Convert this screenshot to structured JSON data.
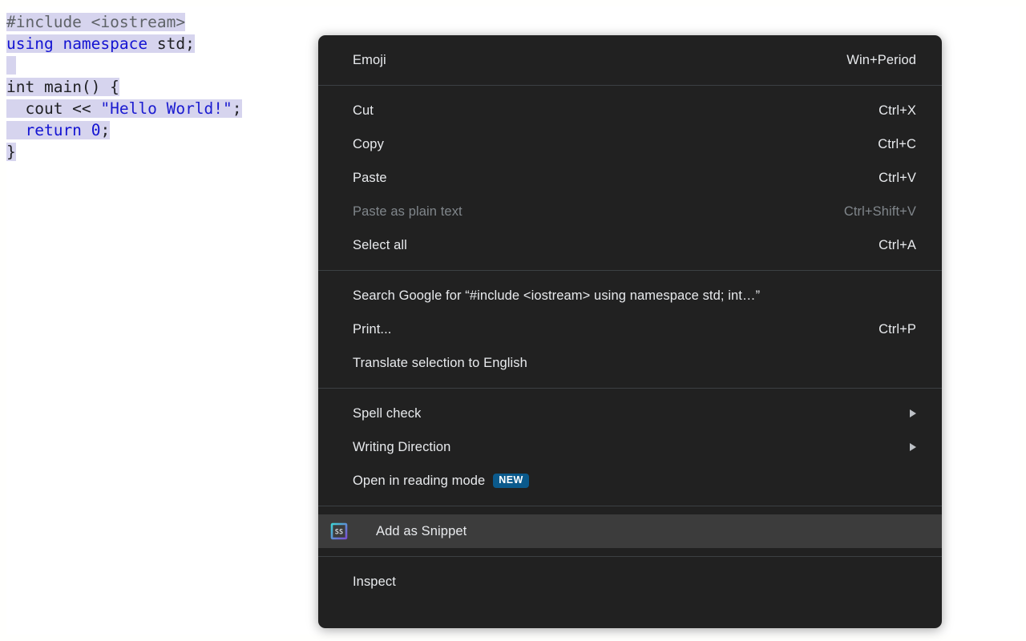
{
  "page": {
    "code_lines": [
      [
        {
          "text": "#include ",
          "type": "preprocessor"
        },
        {
          "text": "<iostream>",
          "type": "preprocessor"
        }
      ],
      [
        {
          "text": "using",
          "type": "keyword"
        },
        {
          "text": " ",
          "type": "plain"
        },
        {
          "text": "namespace",
          "type": "keyword"
        },
        {
          "text": " std;",
          "type": "plain"
        }
      ],
      [],
      [
        {
          "text": "int",
          "type": "plain"
        },
        {
          "text": " main() {",
          "type": "plain"
        }
      ],
      [
        {
          "text": "  cout << ",
          "type": "plain"
        },
        {
          "text": "\"Hello World!\"",
          "type": "string"
        },
        {
          "text": ";",
          "type": "plain"
        }
      ],
      [
        {
          "text": "  ",
          "type": "plain"
        },
        {
          "text": "return",
          "type": "keyword"
        },
        {
          "text": " ",
          "type": "plain"
        },
        {
          "text": "0",
          "type": "number"
        },
        {
          "text": ";",
          "type": "plain"
        }
      ],
      [
        {
          "text": "}",
          "type": "plain"
        }
      ]
    ],
    "code_plain": "#include <iostream>\nusing namespace std;\n\nint main() {\n  cout << \"Hello World!\";\n  return 0;\n}",
    "selection_color": "#d6d4ee"
  },
  "context_menu": {
    "background_color": "#212121",
    "highlight_color": "#3c3c3c",
    "text_color": "#e8eaed",
    "disabled_color": "#80868b",
    "separator_color": "#3c4043",
    "sections": [
      {
        "items": [
          {
            "label": "Emoji",
            "accel": "Win+Period",
            "disabled": false,
            "submenu": false,
            "badge": null,
            "icon": null,
            "highlighted": false
          }
        ]
      },
      {
        "items": [
          {
            "label": "Cut",
            "accel": "Ctrl+X",
            "disabled": false,
            "submenu": false,
            "badge": null,
            "icon": null,
            "highlighted": false
          },
          {
            "label": "Copy",
            "accel": "Ctrl+C",
            "disabled": false,
            "submenu": false,
            "badge": null,
            "icon": null,
            "highlighted": false
          },
          {
            "label": "Paste",
            "accel": "Ctrl+V",
            "disabled": false,
            "submenu": false,
            "badge": null,
            "icon": null,
            "highlighted": false
          },
          {
            "label": "Paste as plain text",
            "accel": "Ctrl+Shift+V",
            "disabled": true,
            "submenu": false,
            "badge": null,
            "icon": null,
            "highlighted": false
          },
          {
            "label": "Select all",
            "accel": "Ctrl+A",
            "disabled": false,
            "submenu": false,
            "badge": null,
            "icon": null,
            "highlighted": false
          }
        ]
      },
      {
        "items": [
          {
            "label": "Search Google for “#include <iostream> using namespace std;  int…”",
            "accel": "",
            "disabled": false,
            "submenu": false,
            "badge": null,
            "icon": null,
            "highlighted": false
          },
          {
            "label": "Print...",
            "accel": "Ctrl+P",
            "disabled": false,
            "submenu": false,
            "badge": null,
            "icon": null,
            "highlighted": false
          },
          {
            "label": "Translate selection to English",
            "accel": "",
            "disabled": false,
            "submenu": false,
            "badge": null,
            "icon": null,
            "highlighted": false
          }
        ]
      },
      {
        "items": [
          {
            "label": "Spell check",
            "accel": "",
            "disabled": false,
            "submenu": true,
            "badge": null,
            "icon": null,
            "highlighted": false
          },
          {
            "label": "Writing Direction",
            "accel": "",
            "disabled": false,
            "submenu": true,
            "badge": null,
            "icon": null,
            "highlighted": false
          },
          {
            "label": "Open in reading mode",
            "accel": "",
            "disabled": false,
            "submenu": false,
            "badge": "NEW",
            "icon": null,
            "highlighted": false
          }
        ]
      },
      {
        "items": [
          {
            "label": "Add as Snippet",
            "accel": "",
            "disabled": false,
            "submenu": false,
            "badge": null,
            "icon": "snippet-icon",
            "highlighted": true
          }
        ]
      },
      {
        "items": [
          {
            "label": "Inspect",
            "accel": "",
            "disabled": false,
            "submenu": false,
            "badge": null,
            "icon": null,
            "highlighted": false
          }
        ]
      }
    ],
    "badge_color": "#0b5a8c",
    "snippet_icon_colors": {
      "start": "#7b4fd4",
      "end": "#3fd0d4"
    }
  }
}
